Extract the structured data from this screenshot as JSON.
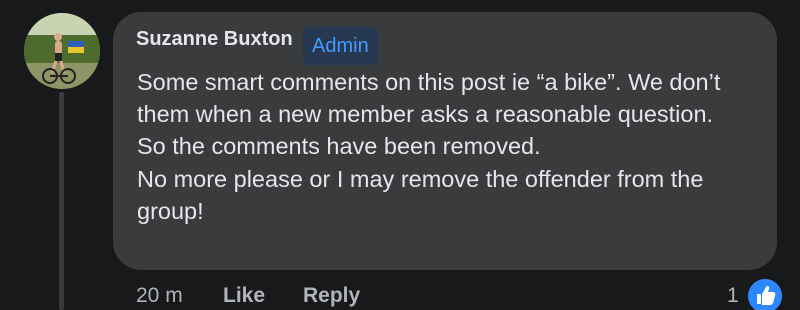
{
  "comment": {
    "author": "Suzanne Buxton",
    "badge": "Admin",
    "lines": [
      "Some smart comments on this post ie “a bike”. We don’t them when a new member asks a reasonable question.",
      "So the comments have been removed.",
      "No more please or I may remove the offender from the group!"
    ],
    "timestamp": "20 m",
    "like_label": "Like",
    "reply_label": "Reply",
    "reaction_count": "1",
    "reaction_icon": "like-thumbs-up-icon"
  },
  "colors": {
    "background": "#18191a",
    "bubble": "#3a3b3c",
    "text": "#e4e6eb",
    "secondary_text": "#b0b3b8",
    "badge_bg": "#263951",
    "badge_text": "#4599ff",
    "like_blue": "#2d88ff"
  }
}
